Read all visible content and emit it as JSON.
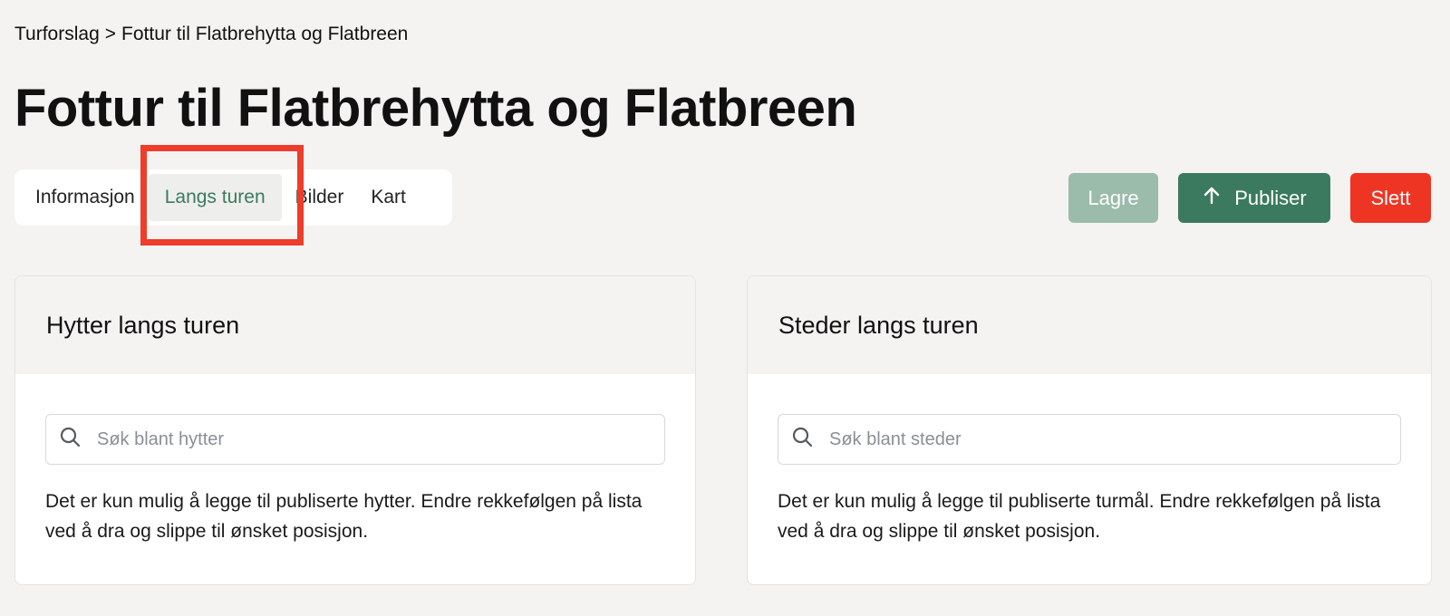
{
  "breadcrumb": {
    "parent": "Turforslag",
    "separator": ">",
    "current": "Fottur til Flatbrehytta og Flatbreen"
  },
  "page": {
    "title": "Fottur til Flatbrehytta og Flatbreen"
  },
  "tabs": [
    {
      "label": "Informasjon",
      "active": false
    },
    {
      "label": "Langs turen",
      "active": true
    },
    {
      "label": "Bilder",
      "active": false
    },
    {
      "label": "Kart",
      "active": false
    }
  ],
  "actions": {
    "save_label": "Lagre",
    "publish_label": "Publiser",
    "delete_label": "Slett"
  },
  "cabins": {
    "title": "Hytter langs turen",
    "search_placeholder": "Søk blant hytter",
    "help_text": "Det er kun mulig å legge til publiserte hytter. Endre rekkefølgen på lista ved å dra og slippe til ønsket posisjon."
  },
  "places": {
    "title": "Steder langs turen",
    "search_placeholder": "Søk blant steder",
    "help_text": "Det er kun mulig å legge til publiserte turmål. Endre rekkefølgen på lista ved å dra og slippe til ønsket posisjon."
  },
  "colors": {
    "background": "#f4f3f2",
    "primary_green": "#3b7a5f",
    "disabled_green": "#9bbbab",
    "danger_red": "#ee3524",
    "highlight_red": "#ee3d2b"
  },
  "icons": {
    "search": "search-icon",
    "publish": "arrow-up-icon"
  }
}
